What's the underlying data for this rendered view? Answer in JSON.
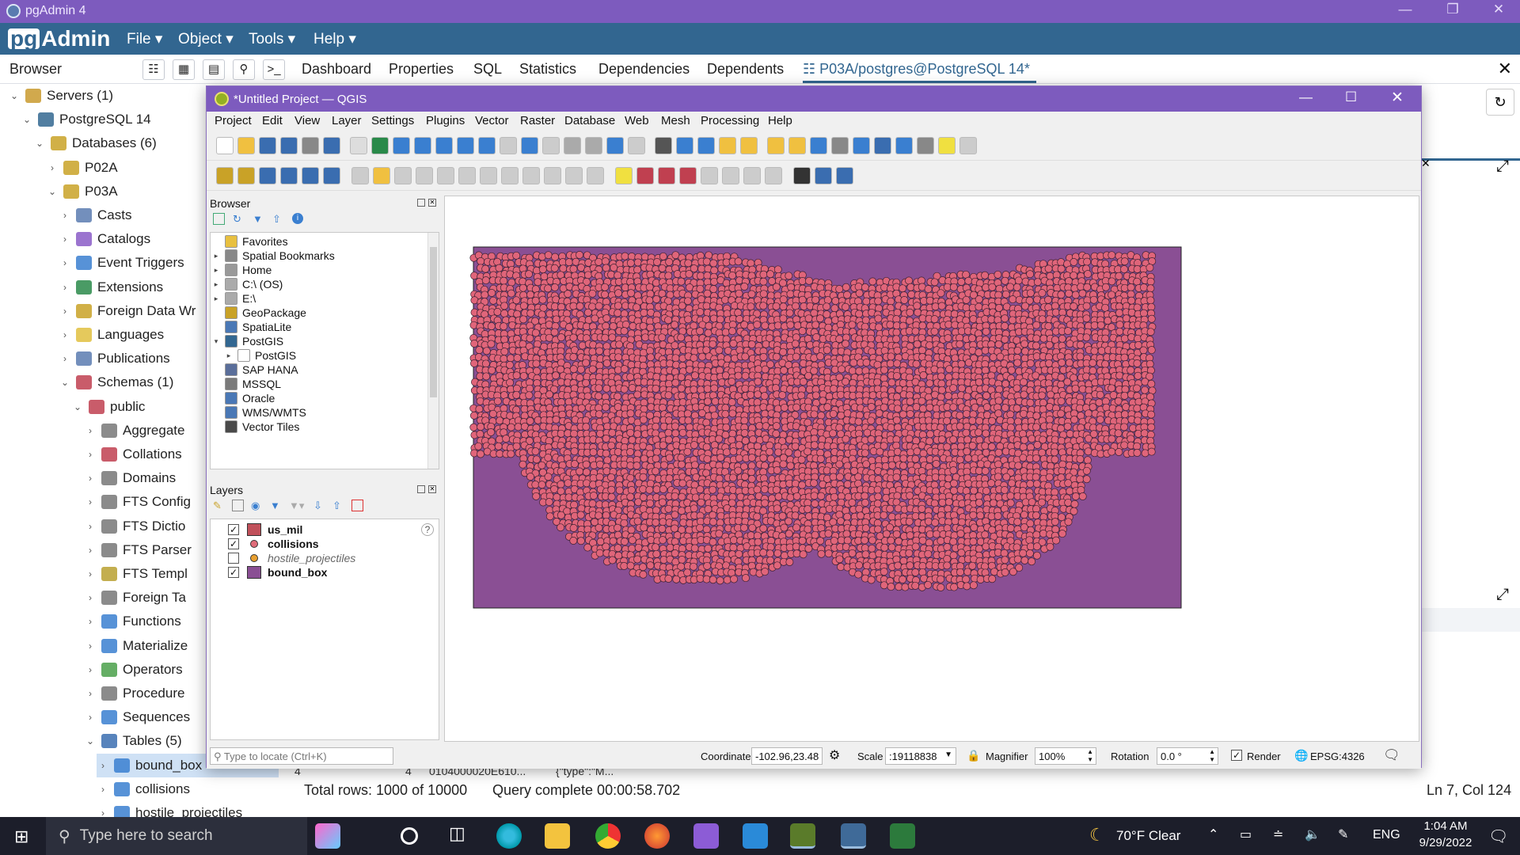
{
  "pgadmin": {
    "window_title": "pgAdmin 4",
    "logo_pg": "pg",
    "logo_admin": "Admin",
    "menu": [
      "File ▾",
      "Object ▾",
      "Tools ▾",
      "Help ▾"
    ],
    "browser_label": "Browser",
    "tabs": [
      "Dashboard",
      "Properties",
      "SQL",
      "Statistics",
      "Dependencies",
      "Dependents"
    ],
    "query_tab": "P03A/postgres@PostgreSQL 14*",
    "tree": [
      {
        "label": "Servers (1)",
        "level": 0,
        "arrow": "⌄",
        "icon": "servers-icon"
      },
      {
        "label": "PostgreSQL 14",
        "level": 1,
        "arrow": "⌄",
        "icon": "postgres-icon"
      },
      {
        "label": "Databases (6)",
        "level": 2,
        "arrow": "⌄",
        "icon": "databases-icon"
      },
      {
        "label": "P02A",
        "level": 3,
        "arrow": "›",
        "icon": "database-icon"
      },
      {
        "label": "P03A",
        "level": 3,
        "arrow": "⌄",
        "icon": "database-icon"
      },
      {
        "label": "Casts",
        "level": 4,
        "arrow": "›",
        "icon": "casts-icon"
      },
      {
        "label": "Catalogs",
        "level": 4,
        "arrow": "›",
        "icon": "catalogs-icon"
      },
      {
        "label": "Event Triggers",
        "level": 4,
        "arrow": "›",
        "icon": "event-triggers-icon"
      },
      {
        "label": "Extensions",
        "level": 4,
        "arrow": "›",
        "icon": "extensions-icon"
      },
      {
        "label": "Foreign Data Wr",
        "level": 4,
        "arrow": "›",
        "icon": "foreign-data-icon"
      },
      {
        "label": "Languages",
        "level": 4,
        "arrow": "›",
        "icon": "languages-icon"
      },
      {
        "label": "Publications",
        "level": 4,
        "arrow": "›",
        "icon": "publications-icon"
      },
      {
        "label": "Schemas (1)",
        "level": 4,
        "arrow": "⌄",
        "icon": "schemas-icon"
      },
      {
        "label": "public",
        "level": 5,
        "arrow": "⌄",
        "icon": "schema-icon"
      },
      {
        "label": "Aggregate",
        "level": 6,
        "arrow": "›",
        "icon": "aggregate-icon"
      },
      {
        "label": "Collations",
        "level": 6,
        "arrow": "›",
        "icon": "collations-icon"
      },
      {
        "label": "Domains",
        "level": 6,
        "arrow": "›",
        "icon": "domains-icon"
      },
      {
        "label": "FTS Config",
        "level": 6,
        "arrow": "›",
        "icon": "fts-config-icon"
      },
      {
        "label": "FTS Dictio",
        "level": 6,
        "arrow": "›",
        "icon": "fts-dictionary-icon"
      },
      {
        "label": "FTS Parser",
        "level": 6,
        "arrow": "›",
        "icon": "fts-parser-icon"
      },
      {
        "label": "FTS Templ",
        "level": 6,
        "arrow": "›",
        "icon": "fts-template-icon"
      },
      {
        "label": "Foreign Ta",
        "level": 6,
        "arrow": "›",
        "icon": "foreign-table-icon"
      },
      {
        "label": "Functions",
        "level": 6,
        "arrow": "›",
        "icon": "functions-icon"
      },
      {
        "label": "Materialize",
        "level": 6,
        "arrow": "›",
        "icon": "materialized-view-icon"
      },
      {
        "label": "Operators",
        "level": 6,
        "arrow": "›",
        "icon": "operators-icon"
      },
      {
        "label": "Procedure",
        "level": 6,
        "arrow": "›",
        "icon": "procedures-icon"
      },
      {
        "label": "Sequences",
        "level": 6,
        "arrow": "›",
        "icon": "sequences-icon"
      },
      {
        "label": "Tables (5)",
        "level": 6,
        "arrow": "⌄",
        "icon": "tables-icon"
      },
      {
        "label": "bound_box",
        "level": 7,
        "arrow": "›",
        "icon": "table-icon"
      },
      {
        "label": "collisions",
        "level": 7,
        "arrow": "›",
        "icon": "table-icon"
      },
      {
        "label": "hostile_projectiles",
        "level": 7,
        "arrow": "›",
        "icon": "table-icon"
      }
    ],
    "result_row": [
      "4",
      "4",
      "0104000020E610...",
      "{\"type\":\"M..."
    ],
    "total_rows": "Total rows: 1000 of 10000",
    "query_complete": "Query complete 00:00:58.702",
    "cursor_pos": "Ln 7, Col 124"
  },
  "qgis": {
    "window_title": "*Untitled Project — QGIS",
    "menu": [
      "Project",
      "Edit",
      "View",
      "Layer",
      "Settings",
      "Plugins",
      "Vector",
      "Raster",
      "Database",
      "Web",
      "Mesh",
      "Processing",
      "Help"
    ],
    "browser_title": "Browser",
    "browser_items": [
      {
        "label": "Favorites",
        "arrow": "",
        "indent": 0,
        "icon": "favorites-icon",
        "color": "#e8c040"
      },
      {
        "label": "Spatial Bookmarks",
        "arrow": "▸",
        "indent": 0,
        "icon": "bookmarks-icon",
        "color": "#888888"
      },
      {
        "label": "Home",
        "arrow": "▸",
        "indent": 0,
        "icon": "home-icon",
        "color": "#999999"
      },
      {
        "label": "C:\\ (OS)",
        "arrow": "▸",
        "indent": 0,
        "icon": "drive-icon",
        "color": "#aaaaaa"
      },
      {
        "label": "E:\\",
        "arrow": "▸",
        "indent": 0,
        "icon": "drive-icon",
        "color": "#aaaaaa"
      },
      {
        "label": "GeoPackage",
        "arrow": "",
        "indent": 0,
        "icon": "geopackage-icon",
        "color": "#c9a227"
      },
      {
        "label": "SpatiaLite",
        "arrow": "",
        "indent": 0,
        "icon": "spatialite-icon",
        "color": "#4a78b5"
      },
      {
        "label": "PostGIS",
        "arrow": "▾",
        "indent": 0,
        "icon": "postgis-icon",
        "color": "#336791"
      },
      {
        "label": "PostGIS",
        "arrow": "▸",
        "indent": 1,
        "icon": "connection-icon",
        "color": "#ffffff"
      },
      {
        "label": "SAP HANA",
        "arrow": "",
        "indent": 0,
        "icon": "sap-hana-icon",
        "color": "#5a6e9a"
      },
      {
        "label": "MSSQL",
        "arrow": "",
        "indent": 0,
        "icon": "mssql-icon",
        "color": "#7a7a7a"
      },
      {
        "label": "Oracle",
        "arrow": "",
        "indent": 0,
        "icon": "oracle-icon",
        "color": "#4a78b5"
      },
      {
        "label": "WMS/WMTS",
        "arrow": "",
        "indent": 0,
        "icon": "wms-icon",
        "color": "#4a78b5"
      },
      {
        "label": "Vector Tiles",
        "arrow": "",
        "indent": 0,
        "icon": "vector-tiles-icon",
        "color": "#4a4a4a"
      }
    ],
    "layers_title": "Layers",
    "layers": [
      {
        "name": "us_mil",
        "checked": "✓",
        "style": "bold",
        "swatch": "#c0505a",
        "shape": "square",
        "extra": "?"
      },
      {
        "name": "collisions",
        "checked": "✓",
        "style": "bold",
        "swatch": "#e06c7a",
        "shape": "dot",
        "extra": ""
      },
      {
        "name": "hostile_projectiles",
        "checked": "",
        "style": "italic",
        "swatch": "#e8a030",
        "shape": "dot",
        "extra": ""
      },
      {
        "name": "bound_box",
        "checked": "✓",
        "style": "bold",
        "swatch": "#8a4f94",
        "shape": "square",
        "extra": ""
      }
    ],
    "locate_placeholder": "Type to locate (Ctrl+K)",
    "status": {
      "coordinate_label": "Coordinate",
      "coordinate_value": "-102.96,23.48",
      "scale_label": "Scale",
      "scale_value": ":19118838",
      "magnifier_label": "Magnifier",
      "magnifier_value": "100%",
      "rotation_label": "Rotation",
      "rotation_value": "0.0 °",
      "render_label": "Render",
      "render_checked": "✓",
      "crs": "EPSG:4326"
    },
    "map_colors": {
      "background": "#8a4f94",
      "points": "#e0657a",
      "point_stroke": "#3a2030"
    }
  },
  "taskbar": {
    "search_placeholder": "Type here to search",
    "weather": "70°F  Clear",
    "lang": "ENG",
    "time": "1:04 AM",
    "date": "9/29/2022"
  }
}
